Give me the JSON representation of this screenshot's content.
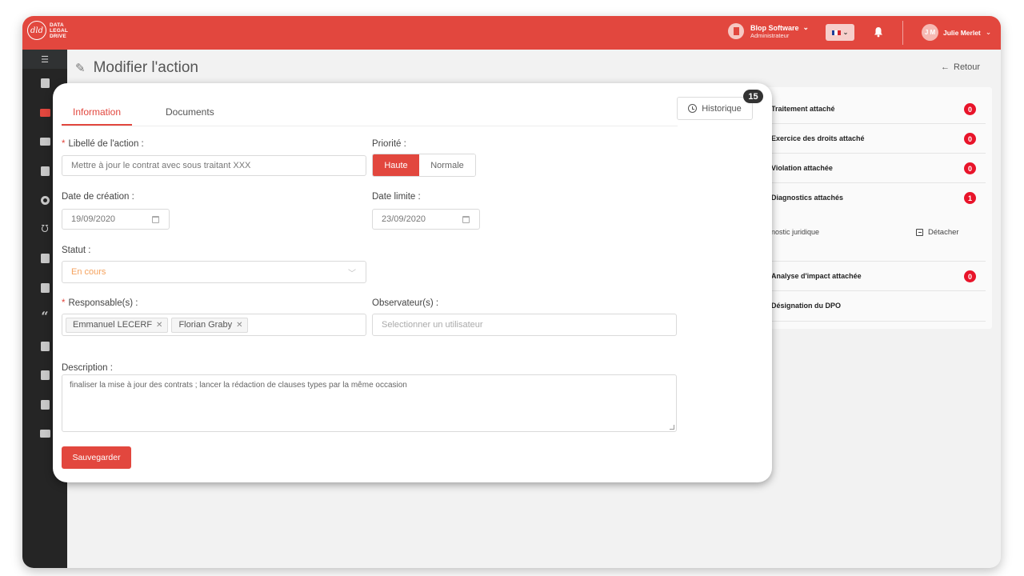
{
  "app": {
    "logo_lines": [
      "DATA",
      "LEGAL",
      "DRIVE"
    ],
    "logo_mark": "dld",
    "brand_color": "#e2473e"
  },
  "topbar": {
    "company_name": "Blop Software",
    "company_role": "Administrateur",
    "company_chevron": "⌄",
    "language_flag": "fr",
    "language_chevron": "⌄",
    "user_initials": "J M",
    "user_name": "Julie Merlet",
    "user_chevron": "⌄"
  },
  "sidebar": {
    "toggle_icon": "☰",
    "items": [
      {
        "icon": "building-icon",
        "active": false
      },
      {
        "icon": "calendar-icon",
        "active": true
      },
      {
        "icon": "table-icon",
        "active": false
      },
      {
        "icon": "document-icon",
        "active": false
      },
      {
        "icon": "target-icon",
        "active": false
      },
      {
        "icon": "stethoscope-icon",
        "active": false
      },
      {
        "icon": "file-lock-icon",
        "active": false
      },
      {
        "icon": "file-pulse-icon",
        "active": false
      },
      {
        "icon": "quote-icon",
        "active": false
      },
      {
        "icon": "user-tie-icon",
        "active": false
      },
      {
        "icon": "book-icon",
        "active": false
      },
      {
        "icon": "clipboard-icon",
        "active": false
      },
      {
        "icon": "id-card-icon",
        "active": false
      }
    ]
  },
  "page": {
    "title": "Modifier l'action",
    "back_label": "Retour",
    "back_arrow": "←"
  },
  "tabs": [
    {
      "label": "Information",
      "active": true
    },
    {
      "label": "Documents",
      "active": false
    }
  ],
  "history": {
    "label": "Historique",
    "count": "15"
  },
  "form": {
    "libelle_label": "Libellé de l'action :",
    "libelle_value": "Mettre à jour le contrat avec sous traitant XXX",
    "priorite_label": "Priorité :",
    "priorite_options": [
      "Haute",
      "Normale"
    ],
    "priorite_selected": "Haute",
    "date_creation_label": "Date de création :",
    "date_creation_value": "19/09/2020",
    "date_limite_label": "Date limite :",
    "date_limite_value": "23/09/2020",
    "statut_label": "Statut :",
    "statut_value": "En cours",
    "statut_color": "#f5a25d",
    "responsables_label": "Responsable(s) :",
    "responsables": [
      "Emmanuel LECERF",
      "Florian Graby"
    ],
    "observateurs_label": "Observateur(s) :",
    "observateurs_placeholder": "Selectionner un utilisateur",
    "description_label": "Description :",
    "description_value": "finaliser la mise à jour des contrats ; lancer la rédaction de clauses types par la même occasion",
    "save_label": "Sauvegarder",
    "required_mark": "*"
  },
  "attachments": {
    "rows": [
      {
        "label": "Traitement attaché",
        "count": "0"
      },
      {
        "label": "Exercice des droits attaché",
        "count": "0"
      },
      {
        "label": "Violation attachée",
        "count": "0"
      },
      {
        "label": "Diagnostics attachés",
        "count": "1"
      }
    ],
    "diagnostic_item": "nostic juridique",
    "detach_label": "Détacher",
    "rows_after": [
      {
        "label": "Analyse d'impact attachée",
        "count": "0"
      },
      {
        "label": "Désignation du DPO",
        "count": null
      }
    ],
    "badge_color": "#e8142a"
  }
}
